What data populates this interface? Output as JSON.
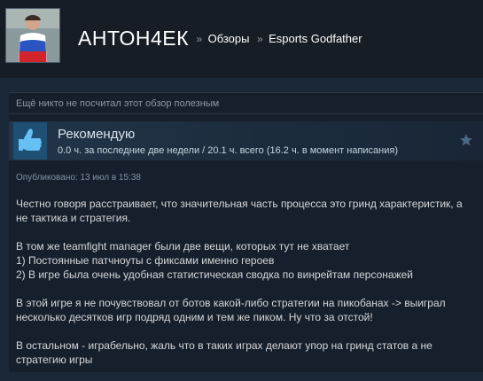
{
  "header": {
    "username": "АНТОН4ЕК",
    "separator": "»",
    "crumb_reviews": "Обзоры",
    "crumb_game": "Esports Godfather"
  },
  "helpful": {
    "text": "Ещё никто не посчитал этот обзор полезным"
  },
  "review": {
    "verdict": "Рекомендую",
    "hours": "0.0 ч. за последние две недели / 20.1 ч. всего (16.2 ч. в момент написания)",
    "posted": "Опубликовано: 13 июл в 15:38",
    "thumb_icon": "thumbs-up-icon",
    "star_icon": "award-star-icon",
    "paragraphs": [
      "Честно говоря расстраивает, что значительная часть процесса это гринд характеристик, а не тактика и стратегия.",
      "В том же teamfight manager были две вещи, которых тут не хватает\n1) Постоянные патчноуты с фиксами именно героев\n2) В игре была очень удобная статистическая сводка по винрейтам персонажей",
      "В этой игре я не почувствовал от ботов какой-либо стратегии на пикобанах -> выиграл несколько десятков игр подряд одним и тем же пиком. Ну что за отстой!",
      "В остальном - играбельно, жаль что в таких играх делают упор на гринд статов а не стратегию игры"
    ]
  },
  "colors": {
    "background": "#1b2838",
    "header_bg": "#171d25",
    "review_bg": "#16202d",
    "thumb_bg": "#1f4f73",
    "thumb_icon": "#66c0f4"
  }
}
